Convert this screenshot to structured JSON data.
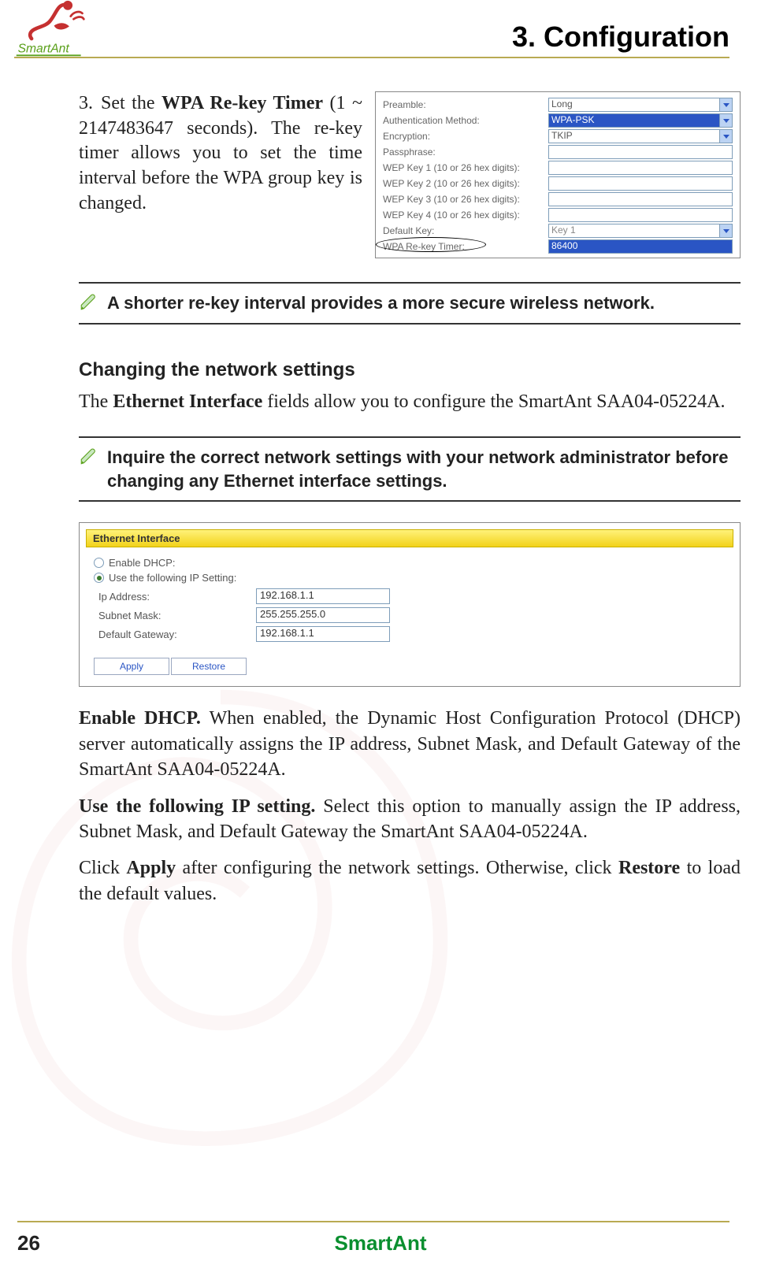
{
  "header": {
    "chapter": "3. Configuration"
  },
  "step3": {
    "number": "3.",
    "text_pre": "Set the",
    "bold": "WPA Re-key Timer",
    "text_post": "(1 ~ 2147483647 seconds). The re-key timer allows you to set the time interval before the WPA group key is changed."
  },
  "shot1": {
    "rows": [
      {
        "label": "Preamble:",
        "value": "Long"
      },
      {
        "label": "Authentication Method:",
        "value": "WPA-PSK"
      },
      {
        "label": "Encryption:",
        "value": "TKIP"
      },
      {
        "label": "Passphrase:",
        "value": ""
      },
      {
        "label": "WEP Key 1 (10 or 26 hex digits):",
        "value": ""
      },
      {
        "label": "WEP Key 2 (10 or 26 hex digits):",
        "value": ""
      },
      {
        "label": "WEP Key 3 (10 or 26 hex digits):",
        "value": ""
      },
      {
        "label": "WEP Key 4 (10 or 26 hex digits):",
        "value": ""
      },
      {
        "label": "Default Key:",
        "value": "Key 1"
      },
      {
        "label": "WPA Re-key Timer:",
        "value": "86400"
      }
    ]
  },
  "notes": {
    "rekey": "A shorter re-key interval provides a more secure wireless network.",
    "admin": "Inquire the correct network settings with your network administrator before changing any Ethernet interface settings."
  },
  "section": {
    "heading": "Changing the network settings",
    "intro_pre": "The",
    "intro_bold": "Ethernet Interface",
    "intro_post": "fields allow you to configure the SmartAnt SAA04-05224A."
  },
  "shot2": {
    "title": "Ethernet Interface",
    "radio1": "Enable DHCP:",
    "radio2": "Use the following IP Setting:",
    "fields": [
      {
        "label": "Ip Address:",
        "value": "192.168.1.1"
      },
      {
        "label": "Subnet Mask:",
        "value": "255.255.255.0"
      },
      {
        "label": "Default Gateway:",
        "value": "192.168.1.1"
      }
    ],
    "buttons": [
      "Apply",
      "Restore"
    ]
  },
  "paras": {
    "dhcp_b": "Enable DHCP.",
    "dhcp": "When enabled, the Dynamic Host Configuration Protocol (DHCP) server automatically assigns the IP address, Subnet Mask, and Default Gateway of the SmartAnt SAA04-05224A.",
    "useip_b": "Use the following IP setting.",
    "useip": "Select this option to manually assign the IP address, Subnet Mask, and Default Gateway the SmartAnt SAA04-05224A.",
    "apply_pre": "Click",
    "apply_b1": "Apply",
    "apply_mid": "after configuring the network settings. Otherwise, click",
    "apply_b2": "Restore",
    "apply_post": "to load the default values."
  },
  "footer": {
    "page": "26",
    "brand": "SmartAnt"
  }
}
